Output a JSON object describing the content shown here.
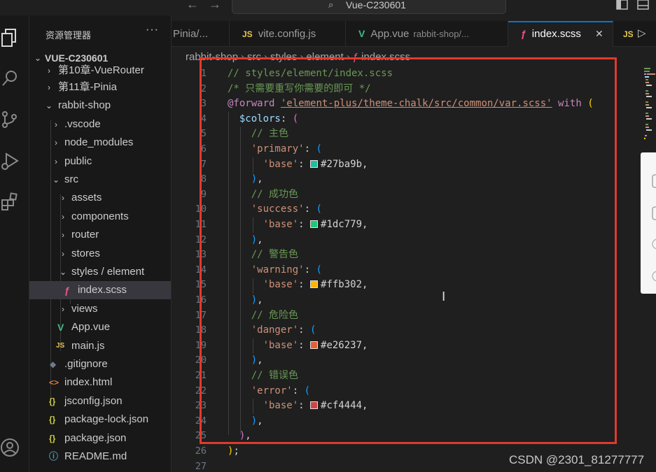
{
  "window": {
    "command_center": "Vue-C230601"
  },
  "sidebar": {
    "header": "资源管理器",
    "more": "···",
    "root": "VUE-C230601",
    "items": [
      {
        "label": "第10章-VueRouter",
        "type": "folder",
        "open": false
      },
      {
        "label": "第11章-Pinia",
        "type": "folder",
        "open": false
      },
      {
        "label": "rabbit-shop",
        "type": "folder",
        "open": true
      },
      {
        "label": ".vscode",
        "type": "folder",
        "open": false
      },
      {
        "label": "node_modules",
        "type": "folder",
        "open": false
      },
      {
        "label": "public",
        "type": "folder",
        "open": false
      },
      {
        "label": "src",
        "type": "folder",
        "open": true
      },
      {
        "label": "assets",
        "type": "folder",
        "open": false
      },
      {
        "label": "components",
        "type": "folder",
        "open": false
      },
      {
        "label": "router",
        "type": "folder",
        "open": false
      },
      {
        "label": "stores",
        "type": "folder",
        "open": false
      },
      {
        "label": "styles / element",
        "type": "folder",
        "open": true
      },
      {
        "label": "index.scss",
        "type": "scss",
        "selected": true
      },
      {
        "label": "views",
        "type": "folder",
        "open": false
      },
      {
        "label": "App.vue",
        "type": "vue"
      },
      {
        "label": "main.js",
        "type": "js"
      },
      {
        "label": ".gitignore",
        "type": "git"
      },
      {
        "label": "index.html",
        "type": "html"
      },
      {
        "label": "jsconfig.json",
        "type": "json"
      },
      {
        "label": "package-lock.json",
        "type": "json"
      },
      {
        "label": "package.json",
        "type": "json"
      },
      {
        "label": "README.md",
        "type": "info"
      }
    ]
  },
  "tabs": [
    {
      "label": "Pinia/...",
      "icon": "",
      "desc": ""
    },
    {
      "label": "vite.config.js",
      "icon": "JS",
      "desc": ""
    },
    {
      "label": "App.vue",
      "icon": "V",
      "desc": "rabbit-shop/..."
    },
    {
      "label": "index.scss",
      "icon": "scss",
      "desc": "",
      "active": true,
      "close": "✕"
    },
    {
      "label": "JS",
      "icon": "",
      "desc": ""
    }
  ],
  "breadcrumb": [
    "rabbit-shop",
    "src",
    "styles",
    "element",
    "index.scss"
  ],
  "editor": {
    "line_numbers": [
      "1",
      "2",
      "3",
      "4",
      "5",
      "6",
      "7",
      "8",
      "9",
      "10",
      "11",
      "12",
      "13",
      "14",
      "15",
      "16",
      "17",
      "18",
      "19",
      "20",
      "21",
      "22",
      "23",
      "24",
      "25",
      "26",
      "27"
    ],
    "l1": "// styles/element/index.scss",
    "l2": "/* 只需要重写你需要的即可 */",
    "l3_kw": "@forward",
    "l3_str": "'element-plus/theme-chalk/src/common/var.scss'",
    "l3_with": "with",
    "l4_var": "$colors",
    "comments": [
      "// 主色",
      "// 成功色",
      "// 警告色",
      "// 危险色",
      "// 错误色"
    ],
    "keys": [
      "'primary'",
      "'success'",
      "'warning'",
      "'danger'",
      "'error'"
    ],
    "base_key": "'base'",
    "colors": [
      "#27ba9b",
      "#1dc779",
      "#ffb302",
      "#e26237",
      "#cf4444"
    ]
  },
  "watermark": "CSDN @2301_81277777",
  "accent_colors": {
    "highlight_box": "#e03a2e",
    "active_tab": "#0078d4"
  }
}
